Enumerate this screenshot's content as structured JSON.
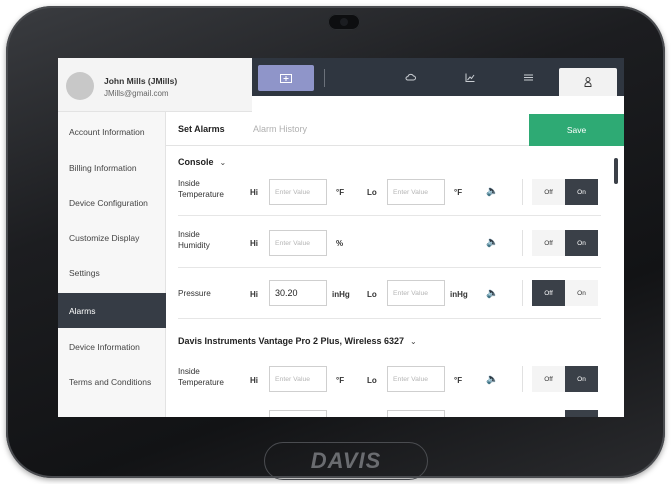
{
  "user": {
    "name": "John Mills (JMills)",
    "email": "JMills@gmail.com"
  },
  "tabs": [
    {
      "icon": "weather-station-icon"
    },
    {
      "icon": "cloud-icon"
    },
    {
      "icon": "chart-icon"
    },
    {
      "icon": "menu-list-icon"
    },
    {
      "icon": "location-pin-icon"
    },
    {
      "icon": "user-icon"
    }
  ],
  "sidebar": {
    "items": [
      {
        "label": "Account Information"
      },
      {
        "label": "Billing Information"
      },
      {
        "label": "Device Configuration"
      },
      {
        "label": "Customize Display"
      },
      {
        "label": "Settings"
      },
      {
        "label": "Alarms",
        "active": true
      },
      {
        "label": "Device Information"
      },
      {
        "label": "Terms and Conditions"
      }
    ]
  },
  "subheader": {
    "set_alarms": "Set Alarms",
    "alarm_history": "Alarm History",
    "save_label": "Save"
  },
  "labels": {
    "hi": "Hi",
    "lo": "Lo",
    "off": "Off",
    "on": "On"
  },
  "placeholder": "Enter Value",
  "sections": [
    {
      "title": "Console",
      "rows": [
        {
          "label_line1": "Inside",
          "label_line2": "Temperature",
          "hi_value": "",
          "hi_unit": "°F",
          "lo_value": "",
          "lo_unit": "°F",
          "state": "On"
        },
        {
          "label_line1": "Inside",
          "label_line2": "Humidity",
          "hi_value": "",
          "hi_unit": "%",
          "state": "On"
        },
        {
          "label_line1": "Pressure",
          "label_line2": "",
          "hi_value": "30.20",
          "hi_unit": "inHg",
          "lo_value": "",
          "lo_unit": "inHg",
          "state": "Off"
        }
      ]
    },
    {
      "title": "Davis Instruments Vantage Pro 2 Plus, Wireless 6327",
      "rows": [
        {
          "label_line1": "Inside",
          "label_line2": "Temperature",
          "hi_value": "",
          "hi_unit": "°F",
          "lo_value": "",
          "lo_unit": "°F",
          "state": "On"
        }
      ]
    }
  ],
  "brand": "DAVIS",
  "colors": {
    "save": "#2eaa74",
    "nav": "#2f3640",
    "active_tab": "#8f95c9",
    "toggle_on": "#3a4048"
  }
}
